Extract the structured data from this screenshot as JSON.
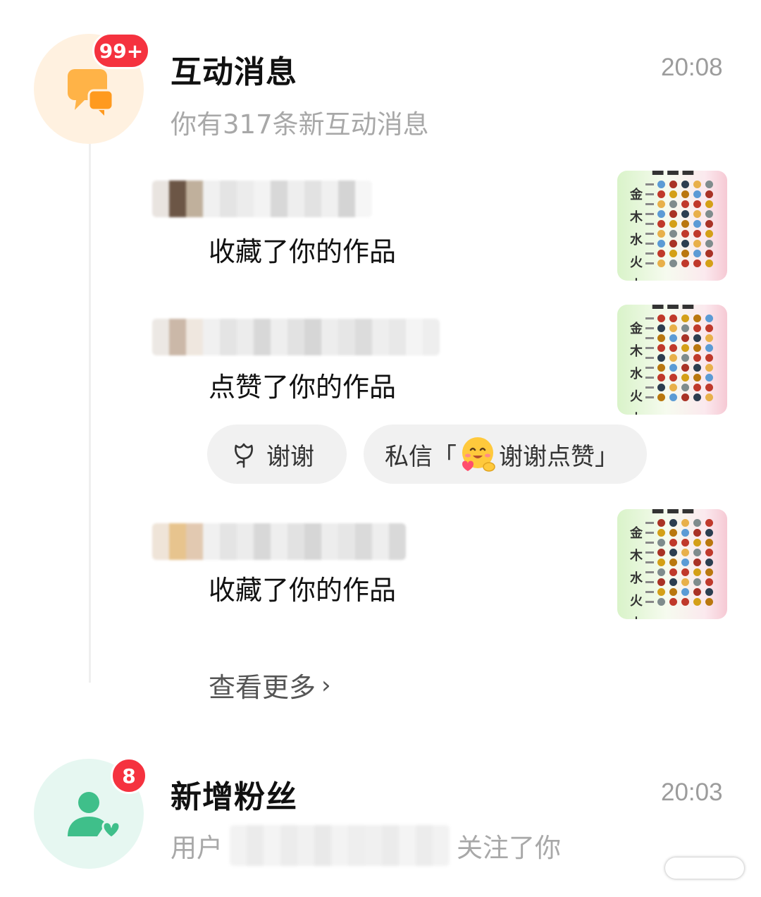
{
  "interaction": {
    "badge": "99+",
    "title": "互动消息",
    "time": "20:08",
    "subtitle": "你有317条新互动消息",
    "icon": "chat-bubbles-icon",
    "items": [
      {
        "action": "收藏了你的作品"
      },
      {
        "action": "点赞了你的作品"
      },
      {
        "action": "收藏了你的作品"
      }
    ],
    "thanks_button": "谢谢",
    "dm_prefix": "私信「",
    "dm_text": "谢谢点赞」",
    "view_more": "查看更多"
  },
  "thumbnail": {
    "side_chars": [
      "金",
      "木",
      "水",
      "火",
      "土"
    ],
    "colors": [
      "#5b9bd5",
      "#c0392b",
      "#a93226",
      "#c0392b",
      "#2c3e50",
      "#d4a017",
      "#e8b04a",
      "#b9770e",
      "#7f8c8d"
    ]
  },
  "follow": {
    "badge": "8",
    "title": "新增粉丝",
    "time": "20:03",
    "text_prefix": "用户",
    "text_suffix": "关注了你",
    "icon": "person-heart-icon"
  }
}
